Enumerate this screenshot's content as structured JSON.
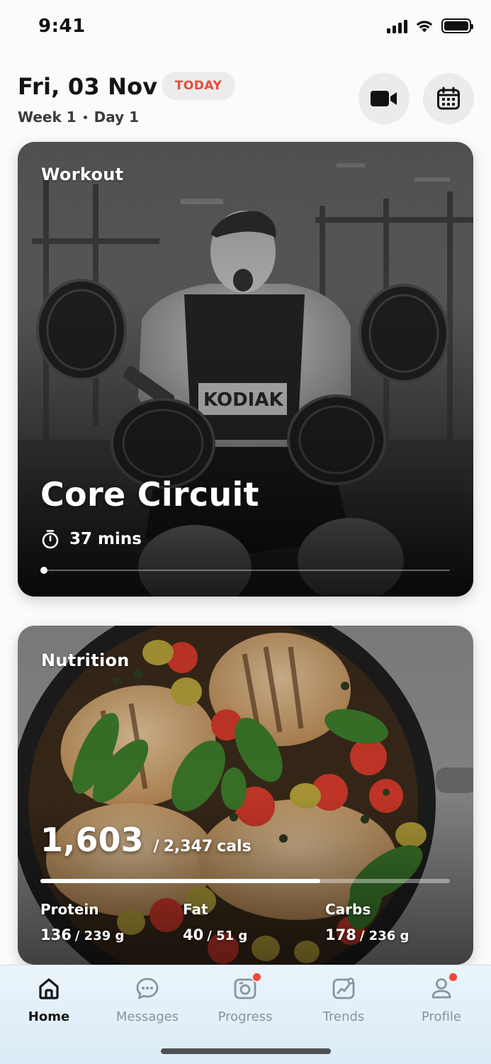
{
  "status_bar": {
    "time": "9:41",
    "signal_icon": "cellular-signal-icon",
    "wifi_icon": "wifi-icon",
    "battery_icon": "battery-icon"
  },
  "header": {
    "date": "Fri, 03 Nov",
    "badge": "TODAY",
    "week": "Week 1",
    "day": "Day 1",
    "video_icon": "video-camera-icon",
    "calendar_icon": "calendar-icon"
  },
  "workout": {
    "label": "Workout",
    "title": "Core Circuit",
    "duration": "37 mins",
    "timer_icon": "stopwatch-icon",
    "progress": 0.0
  },
  "nutrition": {
    "label": "Nutrition",
    "calories": "1,603",
    "separator": "/",
    "calories_goal": "2,347",
    "calories_unit": "cals",
    "progress": 0.683,
    "macros": [
      {
        "name": "Protein",
        "current": "136",
        "rest": "/ 239 g"
      },
      {
        "name": "Fat",
        "current": "40",
        "rest": "/ 51 g"
      },
      {
        "name": "Carbs",
        "current": "178",
        "rest": "/ 236 g"
      }
    ]
  },
  "tabbar": {
    "tabs": [
      {
        "label": "Home",
        "icon": "home-icon",
        "active": true,
        "badge": false
      },
      {
        "label": "Messages",
        "icon": "chat-bubble-icon",
        "active": false,
        "badge": false
      },
      {
        "label": "Progress",
        "icon": "camera-progress-icon",
        "active": false,
        "badge": true
      },
      {
        "label": "Trends",
        "icon": "trend-chart-icon",
        "active": false,
        "badge": false
      },
      {
        "label": "Profile",
        "icon": "user-icon",
        "active": false,
        "badge": true
      }
    ]
  },
  "colors": {
    "accent_red": "#ea4a3c",
    "notification_dot": "#f2473a",
    "active_tab": "#151515",
    "inactive_tab": "#8a939b"
  }
}
